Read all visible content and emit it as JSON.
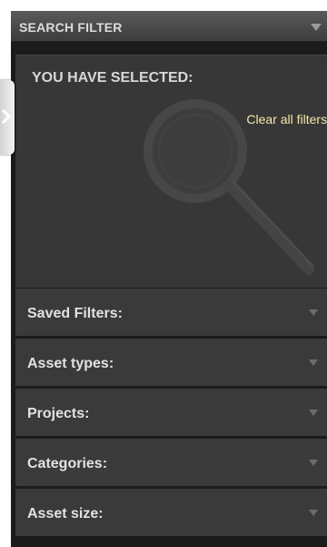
{
  "header": {
    "title": "SEARCH FILTER",
    "collapse_icon": "triangle-down-icon"
  },
  "selected": {
    "title": "YOU HAVE SELECTED:",
    "clear_label": "Clear all filters:",
    "background_icon": "magnifying-glass-icon"
  },
  "toggle": {
    "icon": "chevron-right-icon"
  },
  "accordion": {
    "items": [
      {
        "label": "Saved Filters:"
      },
      {
        "label": "Asset types:"
      },
      {
        "label": "Projects:"
      },
      {
        "label": "Categories:"
      },
      {
        "label": "Asset size:"
      }
    ]
  },
  "colors": {
    "panel": "#1b1b1b",
    "header": "#4a4a4a",
    "section": "#3a3a3a",
    "link": "#f3e6a6"
  }
}
